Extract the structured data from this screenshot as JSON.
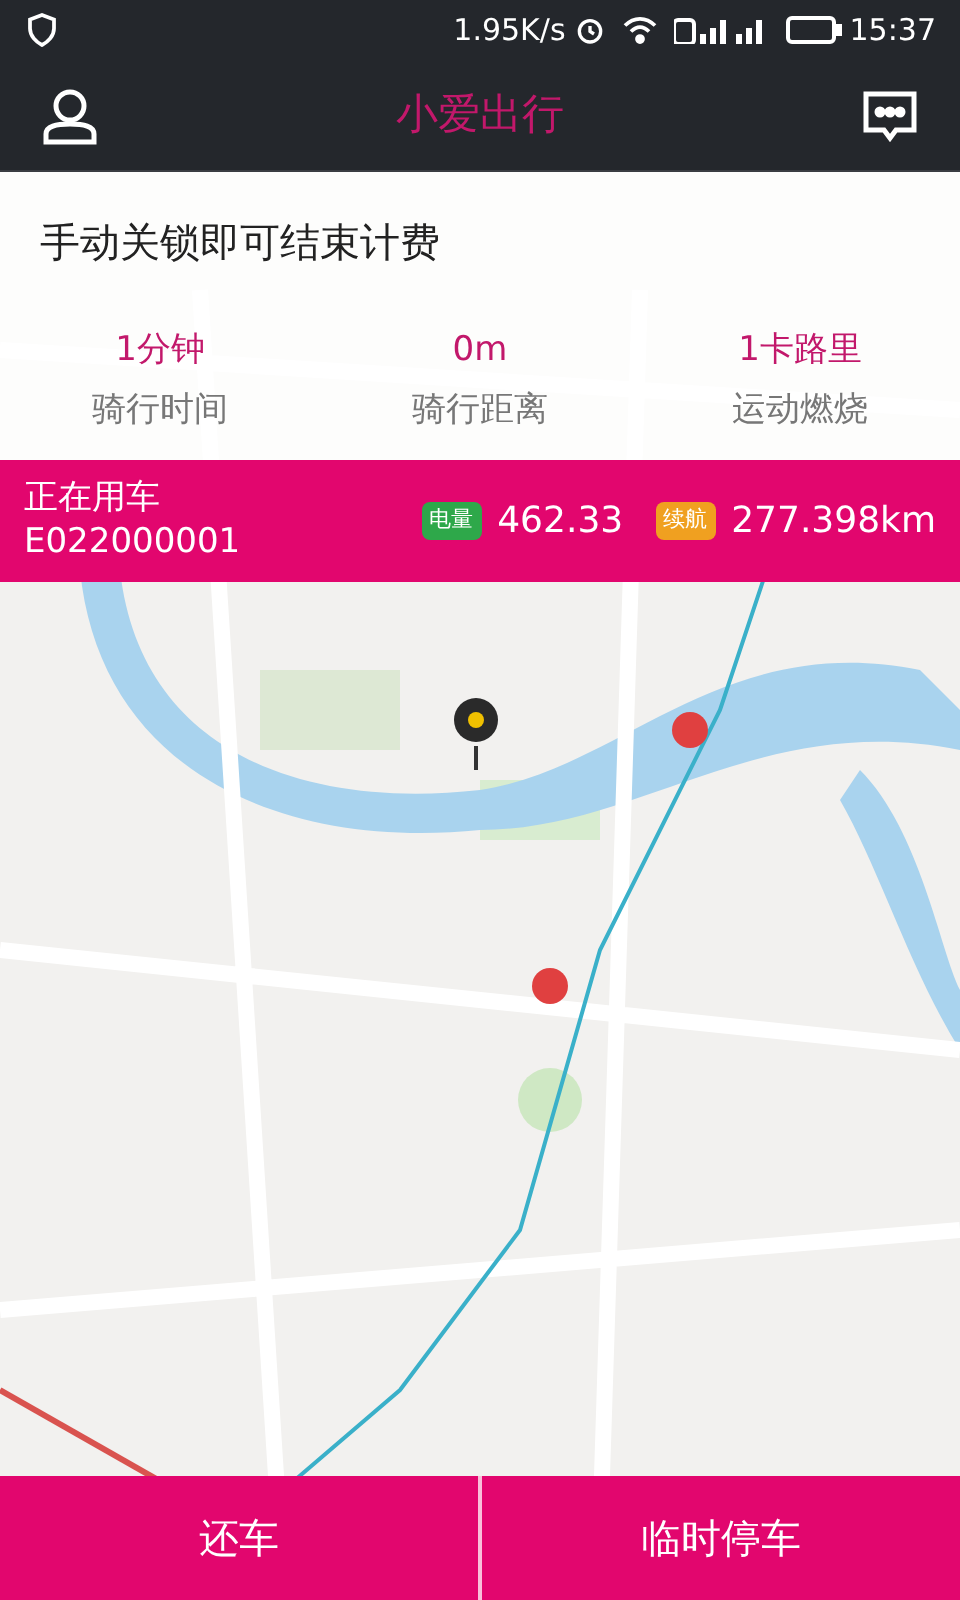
{
  "status_bar": {
    "net_speed": "1.95K/s",
    "time": "15:37"
  },
  "header": {
    "title": "小爱出行"
  },
  "notice": "手动关锁即可结束计费",
  "stats": [
    {
      "value": "1分钟",
      "label": "骑行时间"
    },
    {
      "value": "0m",
      "label": "骑行距离"
    },
    {
      "value": "1卡路里",
      "label": "运动燃烧"
    }
  ],
  "ride": {
    "status": "正在用车",
    "bike_id": "E022000001"
  },
  "meters": [
    {
      "badge": "电量",
      "value": "462.33",
      "color": "#2ea84a"
    },
    {
      "badge": "续航",
      "value": "277.398km",
      "color": "#f0a020"
    }
  ],
  "buttons": [
    "还车",
    "临时停车"
  ]
}
